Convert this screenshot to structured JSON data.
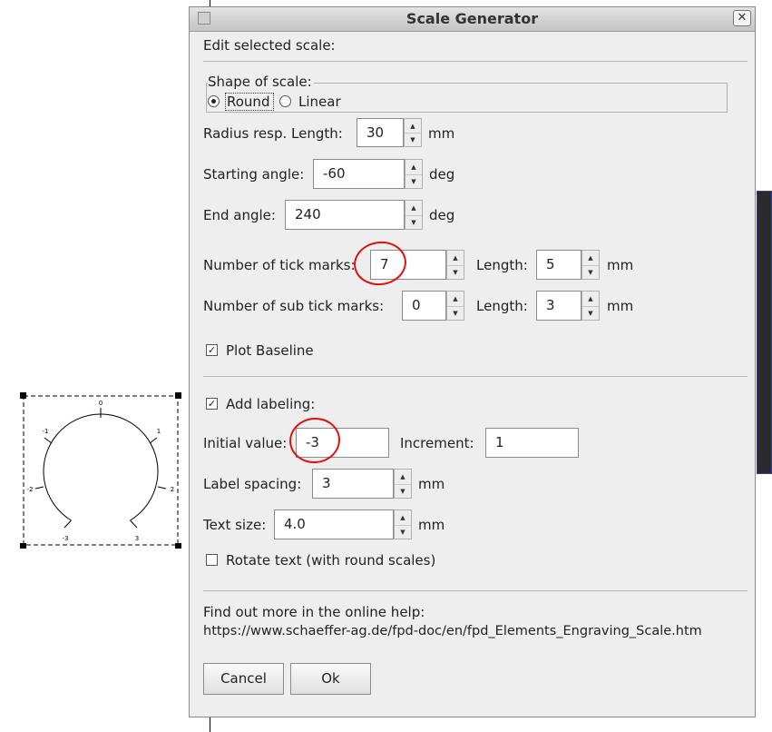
{
  "dialog": {
    "title": "Scale Generator",
    "close_glyph": "✕",
    "intro": "Edit selected scale:",
    "shape": {
      "legend": "Shape of scale:",
      "round_label": "Round",
      "linear_label": "Linear",
      "selected": "Round"
    },
    "radius": {
      "label": "Radius resp. Length:",
      "value": "30",
      "unit": "mm"
    },
    "start_angle": {
      "label": "Starting angle:",
      "value": "-60",
      "unit": "deg"
    },
    "end_angle": {
      "label": "End angle:",
      "value": "240",
      "unit": "deg"
    },
    "ticks": {
      "label": "Number of tick marks:",
      "value": "7",
      "length_label": "Length:",
      "length_value": "5",
      "unit": "mm"
    },
    "sub_ticks": {
      "label": "Number of sub tick marks:",
      "value": "0",
      "length_label": "Length:",
      "length_value": "3",
      "unit": "mm"
    },
    "plot_baseline": {
      "label": "Plot Baseline",
      "checked": true
    },
    "labeling": {
      "label": "Add labeling:",
      "checked": true
    },
    "initial_value": {
      "label": "Initial value:",
      "value": "-3"
    },
    "increment": {
      "label": "Increment:",
      "value": "1"
    },
    "label_spacing": {
      "label": "Label spacing:",
      "value": "3",
      "unit": "mm"
    },
    "text_size": {
      "label": "Text size:",
      "value": "4.0",
      "unit": "mm"
    },
    "rotate_text": {
      "label": "Rotate text (with round scales)",
      "checked": false
    },
    "help": {
      "line1": "Find out more in the online help:",
      "url": "https://www.schaeffer-ag.de/fpd-doc/en/fpd_Elements_Engraving_Scale.htm"
    },
    "buttons": {
      "cancel": "Cancel",
      "ok": "Ok"
    }
  },
  "preview": {
    "labels": [
      "-3",
      "-2",
      "-1",
      "0",
      "1",
      "2",
      "3"
    ]
  },
  "colors": {
    "annotation": "#e01010",
    "dialog_bg": "#eeeeee"
  }
}
